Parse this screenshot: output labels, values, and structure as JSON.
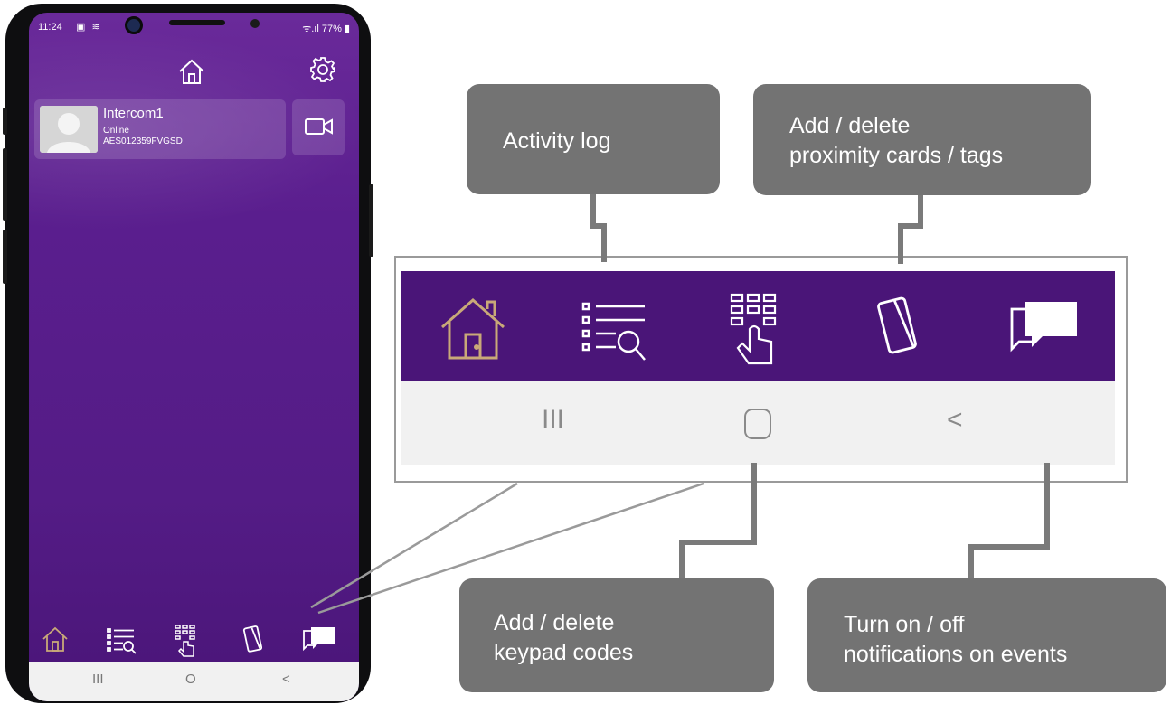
{
  "phone": {
    "status_bar": {
      "time": "11:24",
      "battery": "77%"
    },
    "device": {
      "name": "Intercom1",
      "status": "Online",
      "serial": "AES012359FVGSD"
    },
    "icons": {
      "top_home": "home-icon",
      "settings": "gear-icon",
      "video": "video-camera-icon",
      "nav": [
        "home-icon",
        "activity-log-icon",
        "keypad-icon",
        "card-icon",
        "chat-icon"
      ]
    },
    "system_nav": {
      "recents": "III",
      "home": "O",
      "back": "<"
    }
  },
  "zoom": {
    "system_nav": {
      "recents": "III",
      "back": "<"
    }
  },
  "annotations": {
    "activity_log": [
      "Activity log"
    ],
    "cards_tags": [
      "Add / delete",
      "proximity cards / tags"
    ],
    "keypad_codes": [
      "Add / delete",
      "keypad codes"
    ],
    "notifications": [
      "Turn on / off",
      "notifications on events"
    ]
  },
  "colors": {
    "app_purple": "#541c86",
    "nav_purple": "#4a1578",
    "home_icon_gold": "#c9a978",
    "annotation_gray": "#737373",
    "frame_gray": "#9a9a9a"
  }
}
